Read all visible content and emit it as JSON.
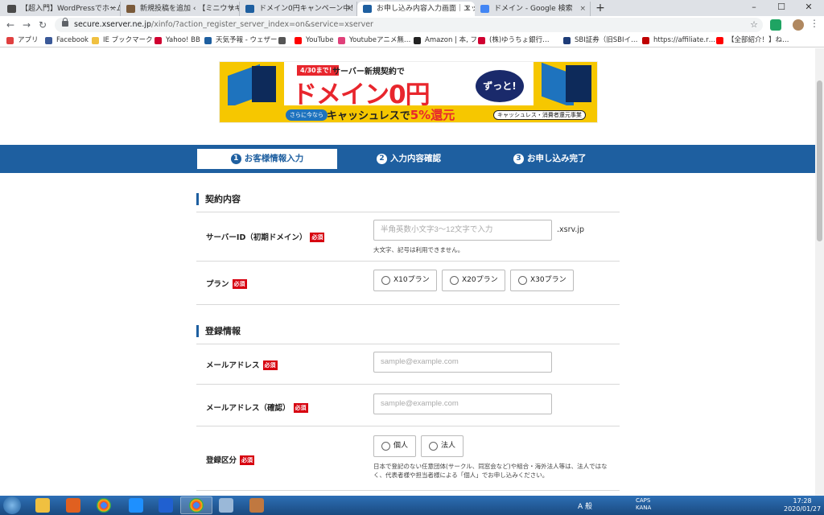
{
  "browser": {
    "tabs": [
      {
        "label": "【超入門】WordPressでホーム",
        "favicon_color": "#4a4a4a"
      },
      {
        "label": "新規投稿を追加 ‹ 【ミニウサギ",
        "favicon_color": "#7a5a3a"
      },
      {
        "label": "ドメイン0円キャンペーン中！|",
        "favicon_color": "#1e5fa0"
      },
      {
        "label": "お申し込み内容入力画面｜エッ",
        "favicon_color": "#1e5fa0"
      },
      {
        "label": "ドメイン - Google 検索",
        "favicon_color": "#4285f4"
      }
    ],
    "tab_close": "×",
    "new_tab": "+",
    "window_controls": {
      "minimize": "–",
      "maximize": "☐",
      "close": "✕"
    },
    "nav": {
      "back": "←",
      "forward": "→",
      "reload": "↻"
    },
    "url_host": "secure.xserver.ne.jp",
    "url_path": "/xinfo/?action_register_server_index=on&service=xserver",
    "star": "☆",
    "menu": "⋮",
    "bookmarks": [
      {
        "label": "アプリ",
        "color": "#e04040"
      },
      {
        "label": "Facebook",
        "color": "#3b5998"
      },
      {
        "label": "IE ブックマーク",
        "color": "#f0c040"
      },
      {
        "label": "Yahoo! BB",
        "color": "#d00030"
      },
      {
        "label": "天気予報 - ウェザー",
        "color": "#1e5fa0"
      },
      {
        "label": "",
        "color": "#555555"
      },
      {
        "label": "YouTube",
        "color": "#ff0000"
      },
      {
        "label": "Youtubeアニメ無…",
        "color": "#e0407a"
      },
      {
        "label": "Amazon | 本, フ…",
        "color": "#222222"
      },
      {
        "label": "(株)ゆうちょ銀行…",
        "color": "#d00030"
      },
      {
        "label": "SBI証券（旧SBIイ…",
        "color": "#1e3c78"
      },
      {
        "label": "https://affiliate.r…",
        "color": "#bf0000"
      },
      {
        "label": "【全部紹介！】ね…",
        "color": "#ff0000"
      }
    ]
  },
  "banner": {
    "tag": "4/30まで！",
    "sub": "サーバー新規契約で",
    "main": "ドメイン0円",
    "zutto": "ずっと!",
    "sarani": "さらに今なら",
    "cash_prefix": "キャッシュレスで",
    "cash_highlight": "5%還元",
    "jigyo": "キャッシュレス・消費者還元事業"
  },
  "steps": [
    {
      "num": "1",
      "label": "お客様情報入力"
    },
    {
      "num": "2",
      "label": "入力内容確認"
    },
    {
      "num": "3",
      "label": "お申し込み完了"
    }
  ],
  "form": {
    "required_badge": "必須",
    "contract": {
      "title": "契約内容",
      "server_id_label": "サーバーID（初期ドメイン）",
      "server_id_placeholder": "半角英数小文字3～12文字で入力",
      "server_id_suffix": ".xsrv.jp",
      "server_id_note": "大文字、記号は利用できません。",
      "plan_label": "プラン",
      "plans": [
        "X10プラン",
        "X20プラン",
        "X30プラン"
      ]
    },
    "registration": {
      "title": "登録情報",
      "email_label": "メールアドレス",
      "email_placeholder": "sample@example.com",
      "email_confirm_label": "メールアドレス（確認）",
      "email_confirm_placeholder": "sample@example.com",
      "type_label": "登録区分",
      "types": [
        "個人",
        "法人"
      ],
      "type_note": "日本で登記のない任意団体(サークル、同窓会など)や組合・海外法人等は、法人ではな\nく、代表者様や担当者様による「個人」でお申し込みください。"
    }
  },
  "taskbar": {
    "time": "17:28",
    "date": "2020/01/27",
    "ime": "A 般",
    "caps": "CAPS\nKANA"
  }
}
